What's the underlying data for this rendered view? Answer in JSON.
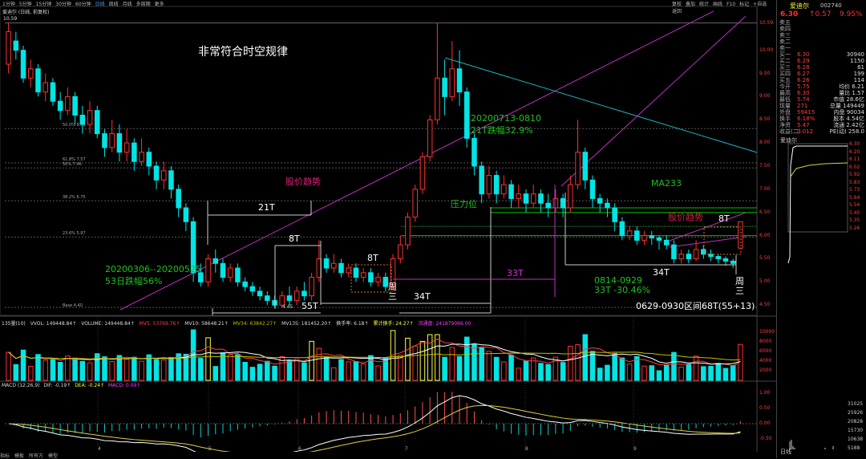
{
  "topbar": {
    "items": [
      "1分钟",
      "5分钟",
      "15分钟",
      "30分钟",
      "60分钟",
      "日线",
      "周线",
      "月线",
      "多周期",
      "更多"
    ],
    "right_items": [
      "复权",
      "叠加",
      "统计",
      "画线",
      "F10",
      "标记",
      "+自选",
      "返回"
    ]
  },
  "header": {
    "stock": "爱迪尔 (日线, 前复权)",
    "high_mark": "10.59"
  },
  "annotations": {
    "title": "非常符合时空规律",
    "trend1": "股价趋势",
    "trend2": "股价趋势",
    "t21": "21T",
    "t8a": "8T",
    "t8b": "8T",
    "t8c": "8T",
    "t55": "55T",
    "t34a": "34T",
    "t34b": "34T",
    "t33": "33T",
    "zhou1": "周\n三",
    "zhou2": "周\n三",
    "range1a": "20200306--20200525",
    "range1b": "53日跌幅56%",
    "range2a": "20200713-0810",
    "range2b": "21T跌幅32.9%",
    "range3a": "0814-0929",
    "range3b": "33T -30.46%",
    "interval": "0629-0930区间68T(55+13)",
    "ma233": "MA233",
    "resistance": "压力位",
    "low_mark": "4.45",
    "base": "Base 4.40"
  },
  "fib_labels": [
    "50.0% 8.31",
    "61.8% 7.57",
    "50% 7.46",
    "38.2% 6.75",
    "23.6% 5.97"
  ],
  "price_axis": [
    "10.59",
    "10.00",
    "9.50",
    "9.00",
    "8.50",
    "8.00",
    "7.50",
    "7.00",
    "6.50",
    "6.00",
    "5.50",
    "5.00",
    "4.50"
  ],
  "volume_bar": {
    "label": "135量(10)",
    "vvol": "VVOL: 149448.84↑",
    "volume": "VOLUME: 149448.84↑",
    "mv5": "MV5: 53769.76↑",
    "mv10": "MV10: 58648.21↑",
    "mv34": "MV34: 63842.27↑",
    "mv135": "MV135: 181452.20↑",
    "turnover": "换手率: 6.18↑",
    "cum_turnover": "累计换手: 24.27↑",
    "float": "流通盘: 241879066.00"
  },
  "volume_axis": [
    "10000",
    "8000",
    "6000",
    "4000",
    "2000"
  ],
  "macd_bar": {
    "label": "MACD (12,26,9)",
    "dif": "DIF: -0.19↑",
    "dea": "DEA: -0.24↑",
    "macd": "MACD: 0.09↑"
  },
  "macd_axis": [
    "1.00",
    "0.50",
    "0.00",
    "-0.50"
  ],
  "x_axis": [
    "4",
    "5",
    "6",
    "7",
    "8",
    "9"
  ],
  "bottombar": {
    "items": [
      "指标",
      "模板",
      "所有方",
      "模型"
    ]
  },
  "right_panel": {
    "name": "爱迪尔",
    "code": "002740",
    "price": "6.30",
    "change": "↑0.57",
    "pct": "9.95%",
    "rows": [
      {
        "l": "卖五",
        "m": "",
        "r": ""
      },
      {
        "l": "卖四",
        "m": "",
        "r": ""
      },
      {
        "l": "卖三",
        "m": "",
        "r": ""
      },
      {
        "l": "卖二",
        "m": "",
        "r": ""
      },
      {
        "l": "卖一",
        "m": "",
        "r": ""
      },
      {
        "l": "买一",
        "m": "6.30",
        "r": "30940"
      },
      {
        "l": "买二",
        "m": "6.29",
        "r": "1150"
      },
      {
        "l": "买三",
        "m": "6.28",
        "r": "61"
      },
      {
        "l": "买四",
        "m": "6.27",
        "r": "199"
      },
      {
        "l": "买五",
        "m": "6.26",
        "r": "114"
      },
      {
        "l": "今开",
        "m": "5.75",
        "r": "均价 6.21"
      },
      {
        "l": "最高",
        "m": "6.30",
        "r": "量比 1.57"
      },
      {
        "l": "最低",
        "m": "5.74",
        "r": "市值 28.6亿"
      },
      {
        "l": "现量",
        "m": "271",
        "r": "总量 149449"
      },
      {
        "l": "外盘",
        "m": "59415",
        "r": "内盘 90034"
      },
      {
        "l": "换手",
        "m": "6.18%",
        "r": "股本 4.54亿"
      },
      {
        "l": "净资",
        "m": "5.47",
        "r": "流通 2.42亿"
      },
      {
        "l": "收益(二)",
        "m": "0.012",
        "r": "PE(动) 258.0"
      }
    ],
    "intraday_title": "爱迪尔",
    "intraday_axis": [
      "6.30",
      "6.20",
      "6.11",
      "6.02",
      "5.92",
      "5.83",
      "5.73",
      "5.64",
      "5.54",
      "5.45",
      "5.35",
      "5.26"
    ],
    "intraday_vol_axis": [
      "31025",
      "25926",
      "20828",
      "15730",
      "10638",
      "5188"
    ],
    "footer": "日线"
  },
  "colors": {
    "up": "#ff3030",
    "down": "#00e5e5",
    "macd_up": "#ff5050",
    "macd_down": "#00d0d0",
    "ma233": "#00c000",
    "trend": "#c030c0",
    "cyan_line": "#20b0c0"
  },
  "chart_data": {
    "type": "candlestick",
    "note_axis": "price",
    "candles": [
      [
        9.7,
        10.4,
        10.6,
        9.5
      ],
      [
        10.2,
        10.0,
        10.4,
        9.8
      ],
      [
        10.0,
        9.4,
        10.1,
        9.3
      ],
      [
        9.4,
        9.6,
        9.8,
        9.2
      ],
      [
        9.6,
        9.1,
        9.7,
        9.0
      ],
      [
        9.1,
        9.3,
        9.5,
        8.9
      ],
      [
        9.3,
        8.9,
        9.4,
        8.8
      ],
      [
        8.9,
        8.7,
        9.1,
        8.5
      ],
      [
        8.7,
        9.0,
        9.2,
        8.6
      ],
      [
        9.0,
        8.6,
        9.1,
        8.4
      ],
      [
        8.6,
        8.4,
        8.8,
        8.2
      ],
      [
        8.4,
        8.7,
        8.9,
        8.2
      ],
      [
        8.7,
        8.2,
        8.8,
        8.1
      ],
      [
        8.2,
        7.9,
        8.3,
        7.7
      ],
      [
        7.9,
        8.2,
        8.5,
        7.8
      ],
      [
        8.2,
        7.8,
        8.4,
        7.6
      ],
      [
        7.8,
        8.0,
        8.3,
        7.6
      ],
      [
        8.0,
        7.6,
        8.1,
        7.4
      ],
      [
        7.6,
        7.8,
        8.1,
        7.5
      ],
      [
        7.8,
        7.5,
        7.9,
        7.3
      ],
      [
        7.5,
        7.2,
        7.6,
        7.0
      ],
      [
        7.2,
        7.4,
        7.6,
        7.0
      ],
      [
        7.4,
        7.0,
        7.5,
        6.8
      ],
      [
        7.0,
        6.6,
        7.1,
        6.4
      ],
      [
        6.6,
        6.3,
        6.7,
        6.1
      ],
      [
        6.3,
        5.2,
        6.4,
        5.0
      ],
      [
        5.2,
        5.0,
        5.4,
        4.9
      ],
      [
        5.0,
        5.5,
        5.6,
        4.9
      ],
      [
        5.5,
        5.4,
        5.7,
        5.2
      ],
      [
        5.4,
        5.1,
        5.5,
        5.0
      ],
      [
        5.1,
        5.3,
        5.4,
        5.0
      ],
      [
        5.3,
        5.0,
        5.4,
        4.9
      ],
      [
        5.0,
        4.9,
        5.1,
        4.8
      ],
      [
        4.9,
        4.8,
        5.0,
        4.7
      ],
      [
        4.8,
        4.7,
        4.9,
        4.6
      ],
      [
        4.7,
        4.6,
        4.8,
        4.5
      ],
      [
        4.6,
        4.5,
        4.7,
        4.45
      ],
      [
        4.5,
        4.7,
        4.8,
        4.45
      ],
      [
        4.7,
        4.6,
        4.9,
        4.5
      ],
      [
        4.6,
        4.8,
        4.9,
        4.5
      ],
      [
        4.8,
        4.7,
        5.0,
        4.6
      ],
      [
        4.7,
        5.1,
        5.2,
        4.6
      ],
      [
        5.1,
        5.5,
        5.9,
        5.0
      ],
      [
        5.5,
        5.3,
        5.6,
        5.2
      ],
      [
        5.3,
        5.4,
        5.6,
        5.2
      ],
      [
        5.4,
        5.2,
        5.5,
        5.1
      ],
      [
        5.2,
        5.3,
        5.4,
        5.1
      ],
      [
        5.3,
        5.1,
        5.4,
        5.0
      ],
      [
        5.1,
        5.2,
        5.3,
        5.0
      ],
      [
        5.2,
        5.0,
        5.3,
        4.9
      ],
      [
        5.0,
        5.1,
        5.2,
        4.9
      ],
      [
        5.1,
        4.9,
        5.2,
        4.8
      ],
      [
        4.9,
        5.5,
        5.6,
        4.8
      ],
      [
        5.5,
        5.8,
        6.0,
        5.4
      ],
      [
        5.8,
        6.4,
        6.5,
        5.7
      ],
      [
        6.4,
        7.0,
        7.1,
        6.3
      ],
      [
        7.0,
        7.7,
        7.8,
        6.9
      ],
      [
        7.7,
        8.5,
        8.6,
        7.6
      ],
      [
        8.5,
        9.4,
        10.6,
        8.4
      ],
      [
        9.4,
        9.0,
        9.8,
        8.6
      ],
      [
        9.0,
        9.6,
        10.2,
        8.9
      ],
      [
        9.6,
        9.1,
        10.0,
        8.8
      ],
      [
        9.1,
        8.1,
        9.2,
        7.9
      ],
      [
        8.1,
        7.5,
        8.2,
        7.3
      ],
      [
        7.5,
        6.9,
        7.6,
        6.7
      ],
      [
        6.9,
        7.3,
        7.5,
        6.8
      ],
      [
        7.3,
        6.9,
        7.4,
        6.7
      ],
      [
        6.9,
        7.1,
        7.3,
        6.8
      ],
      [
        7.1,
        6.8,
        7.2,
        6.6
      ],
      [
        6.8,
        6.9,
        7.1,
        6.6
      ],
      [
        6.9,
        6.7,
        7.0,
        6.5
      ],
      [
        6.7,
        6.9,
        7.1,
        6.6
      ],
      [
        6.9,
        6.7,
        7.0,
        6.5
      ],
      [
        6.7,
        6.6,
        6.9,
        6.4
      ],
      [
        6.6,
        6.8,
        7.0,
        6.5
      ],
      [
        6.8,
        6.6,
        6.9,
        6.4
      ],
      [
        6.6,
        7.1,
        7.3,
        6.5
      ],
      [
        7.1,
        7.8,
        8.5,
        7.0
      ],
      [
        7.8,
        7.2,
        7.9,
        7.0
      ],
      [
        7.2,
        6.8,
        7.3,
        6.6
      ],
      [
        6.8,
        6.7,
        6.9,
        6.5
      ],
      [
        6.7,
        6.6,
        6.8,
        6.4
      ],
      [
        6.6,
        6.3,
        6.7,
        6.1
      ],
      [
        6.3,
        6.0,
        6.4,
        5.9
      ],
      [
        6.0,
        6.1,
        6.2,
        5.9
      ],
      [
        6.1,
        5.9,
        6.2,
        5.8
      ],
      [
        5.9,
        6.0,
        6.1,
        5.8
      ],
      [
        6.0,
        5.95,
        6.1,
        5.8
      ],
      [
        5.95,
        5.9,
        6.0,
        5.7
      ],
      [
        5.9,
        5.8,
        6.0,
        5.7
      ],
      [
        5.8,
        5.5,
        5.9,
        5.4
      ],
      [
        5.5,
        5.6,
        5.7,
        5.4
      ],
      [
        5.6,
        5.5,
        5.7,
        5.4
      ],
      [
        5.5,
        5.7,
        5.9,
        5.45
      ],
      [
        5.7,
        5.6,
        5.8,
        5.5
      ],
      [
        5.6,
        5.55,
        5.7,
        5.45
      ],
      [
        5.55,
        5.5,
        5.6,
        5.4
      ],
      [
        5.5,
        5.45,
        5.55,
        5.35
      ],
      [
        5.45,
        5.4,
        5.5,
        5.3
      ],
      [
        5.73,
        6.3,
        6.3,
        5.74
      ]
    ],
    "ylim": [
      4.4,
      10.6
    ]
  }
}
